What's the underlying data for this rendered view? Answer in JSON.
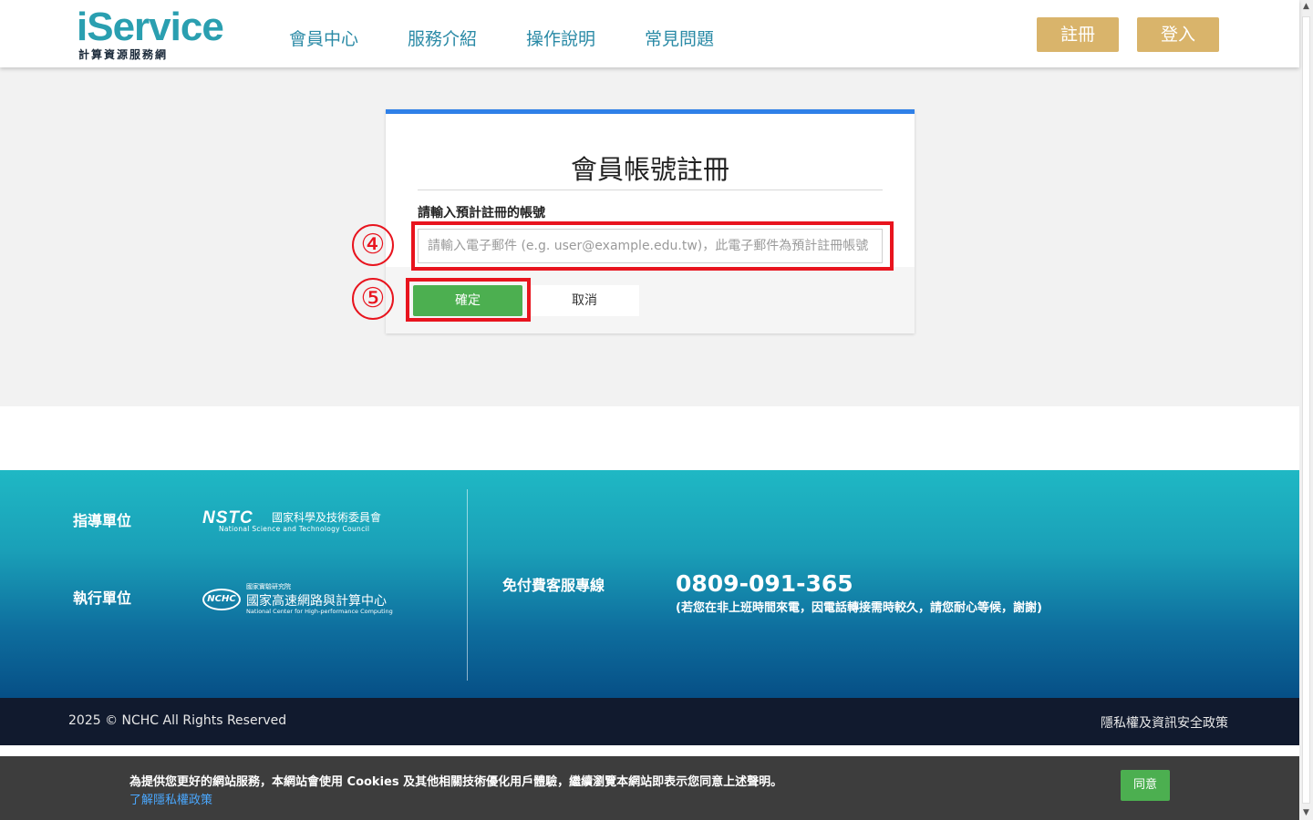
{
  "header": {
    "logo_main": "iService",
    "logo_sub": "計算資源服務網",
    "nav": [
      "會員中心",
      "服務介紹",
      "操作說明",
      "常見問題"
    ],
    "register_label": "註冊",
    "login_label": "登入"
  },
  "form": {
    "title": "會員帳號註冊",
    "field_label": "請輸入預計註冊的帳號",
    "input_placeholder": "請輸入電子郵件 (e.g. user@example.edu.tw)，此電子郵件為預計註冊帳號",
    "input_value": "",
    "confirm_label": "確定",
    "cancel_label": "取消"
  },
  "annotations": {
    "step4": "④",
    "step5": "⑤",
    "color": "#e8141e"
  },
  "footer": {
    "guide_label": "指導單位",
    "exec_label": "執行單位",
    "nstc_mark": "NSTC",
    "nstc_cn": "國家科學及技術委員會",
    "nstc_en": "National Science and Technology Council",
    "nchc_mark": "NCHC",
    "nchc_narl": "國家實驗研究院",
    "nchc_cn": "國家高速網路與計算中心",
    "nchc_en": "National Center for High-performance Computing",
    "hotline_label": "免付費客服專線",
    "phone": "0809-091-365",
    "phone_note": "(若您在非上班時間來電，因電話轉接需時較久，請您耐心等候，謝謝)",
    "copyright": "2025 © NCHC All Rights Reserved",
    "policy": "隱私權及資訊安全政策"
  },
  "cookie": {
    "text": "為提供您更好的網站服務，本網站會使用 Cookies 及其他相關技術優化用戶體驗，繼續瀏覽本網站即表示您同意上述聲明。",
    "link": "了解隱私權政策",
    "agree_label": "同意"
  },
  "colors": {
    "accent_blue": "#2f80e8",
    "gold": "#d9b46b",
    "green": "#4caf50",
    "nav_teal": "#2a8aa6"
  }
}
